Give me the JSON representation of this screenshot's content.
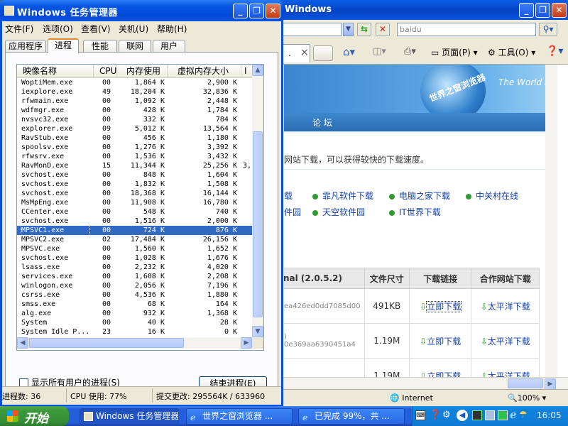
{
  "colors": {
    "xp_blue": "#0a4fd8",
    "selection": "#316ac5",
    "start_green": "#3c9a3c",
    "link": "#1440a6"
  },
  "browser": {
    "title": "Windows",
    "address_text": "baidu",
    "tab_close": "×",
    "toolbar": {
      "page": "页面(P)",
      "tools": "工具(O)"
    },
    "banner_text": "世界之窗浏览器",
    "banner_en": "The World B",
    "nav": "论 坛",
    "notice": "网站下载，可以获得较快的下载速度。",
    "mirrors_row1": [
      "载",
      "霏凡软件下载",
      "电脑之家下载",
      "中关村在线"
    ],
    "mirrors_row2": [
      "件园",
      "天空软件园",
      "IT世界下载"
    ],
    "table": {
      "headers": [
        "nal (2.0.5.2)",
        "文件尺寸",
        "下载链接",
        "合作网站下载"
      ],
      "rows": [
        {
          "name": "",
          "hash": "ea426ed0dd7085d00",
          "size": "491KB",
          "link": "立即下载",
          "partner": "太平洋下载"
        },
        {
          "name": ")",
          "hash": "0e369aa6390451a4",
          "size": "1.19M",
          "link": "立即下载",
          "partner": "太平洋下载"
        },
        {
          "name": "",
          "hash": "",
          "size": "1.19M",
          "link": "立即下载",
          "partner": "太平洋下载"
        }
      ]
    },
    "status": {
      "zone": "Internet",
      "zoom": "100%"
    }
  },
  "tm": {
    "title": "Windows 任务管理器",
    "menu": [
      "文件(F)",
      "选项(O)",
      "查看(V)",
      "关机(U)",
      "帮助(H)"
    ],
    "tabs": [
      "应用程序",
      "进程",
      "性能",
      "联网",
      "用户"
    ],
    "columns": [
      "映像名称",
      "CPU",
      "内存使用",
      "虚拟内存大小",
      "I"
    ],
    "processes": [
      {
        "name": "WoptiMem.exe",
        "cpu": "00",
        "mem": "1,864 K",
        "vm": "2,900 K",
        "extra": ""
      },
      {
        "name": "iexplore.exe",
        "cpu": "49",
        "mem": "18,204 K",
        "vm": "32,836 K",
        "extra": ""
      },
      {
        "name": "rfwmain.exe",
        "cpu": "00",
        "mem": "1,092 K",
        "vm": "2,448 K",
        "extra": ""
      },
      {
        "name": "wdfmgr.exe",
        "cpu": "00",
        "mem": "428 K",
        "vm": "1,784 K",
        "extra": ""
      },
      {
        "name": "nvsvc32.exe",
        "cpu": "00",
        "mem": "332 K",
        "vm": "784 K",
        "extra": ""
      },
      {
        "name": "explorer.exe",
        "cpu": "09",
        "mem": "5,012 K",
        "vm": "13,564 K",
        "extra": ""
      },
      {
        "name": "RavStub.exe",
        "cpu": "00",
        "mem": "456 K",
        "vm": "1,180 K",
        "extra": ""
      },
      {
        "name": "spoolsv.exe",
        "cpu": "00",
        "mem": "1,276 K",
        "vm": "3,392 K",
        "extra": ""
      },
      {
        "name": "rfwsrv.exe",
        "cpu": "00",
        "mem": "1,536 K",
        "vm": "3,432 K",
        "extra": ""
      },
      {
        "name": "RavMonD.exe",
        "cpu": "15",
        "mem": "11,344 K",
        "vm": "25,256 K",
        "extra": "3,"
      },
      {
        "name": "svchost.exe",
        "cpu": "00",
        "mem": "848 K",
        "vm": "1,604 K",
        "extra": ""
      },
      {
        "name": "svchost.exe",
        "cpu": "00",
        "mem": "1,832 K",
        "vm": "1,508 K",
        "extra": ""
      },
      {
        "name": "svchost.exe",
        "cpu": "00",
        "mem": "18,368 K",
        "vm": "16,144 K",
        "extra": ""
      },
      {
        "name": "MsMpEng.exe",
        "cpu": "00",
        "mem": "11,908 K",
        "vm": "16,780 K",
        "extra": ""
      },
      {
        "name": "CCenter.exe",
        "cpu": "00",
        "mem": "548 K",
        "vm": "740 K",
        "extra": ""
      },
      {
        "name": "svchost.exe",
        "cpu": "00",
        "mem": "1,516 K",
        "vm": "2,000 K",
        "extra": ""
      },
      {
        "name": "MPSVC1.exe",
        "cpu": "00",
        "mem": "724 K",
        "vm": "876 K",
        "extra": ""
      },
      {
        "name": "MPSVC2.exe",
        "cpu": "02",
        "mem": "17,484 K",
        "vm": "26,156 K",
        "extra": ""
      },
      {
        "name": "MPSVC.exe",
        "cpu": "00",
        "mem": "1,560 K",
        "vm": "1,652 K",
        "extra": ""
      },
      {
        "name": "svchost.exe",
        "cpu": "00",
        "mem": "1,028 K",
        "vm": "1,676 K",
        "extra": ""
      },
      {
        "name": "lsass.exe",
        "cpu": "00",
        "mem": "2,232 K",
        "vm": "4,020 K",
        "extra": ""
      },
      {
        "name": "services.exe",
        "cpu": "00",
        "mem": "1,608 K",
        "vm": "2,208 K",
        "extra": ""
      },
      {
        "name": "winlogon.exe",
        "cpu": "00",
        "mem": "2,056 K",
        "vm": "7,196 K",
        "extra": ""
      },
      {
        "name": "csrss.exe",
        "cpu": "00",
        "mem": "4,536 K",
        "vm": "1,880 K",
        "extra": ""
      },
      {
        "name": "smss.exe",
        "cpu": "00",
        "mem": "68 K",
        "vm": "164 K",
        "extra": ""
      },
      {
        "name": "alg.exe",
        "cpu": "00",
        "mem": "932 K",
        "vm": "1,368 K",
        "extra": ""
      },
      {
        "name": "System",
        "cpu": "00",
        "mem": "40 K",
        "vm": "28 K",
        "extra": ""
      },
      {
        "name": "System Idle P...",
        "cpu": "23",
        "mem": "16 K",
        "vm": "0 K",
        "extra": ""
      }
    ],
    "selected_process": "MPSVC1.exe",
    "show_all": "显示所有用户的进程(S)",
    "end_process": "结束进程(E)",
    "status": {
      "procs": "进程数: 36",
      "cpu": "CPU 使用: 77%",
      "commit": "提交更改: 295564K / 633960"
    }
  },
  "taskbar": {
    "start": "开始",
    "buttons": [
      "Windows 任务管理器",
      "世界之窗浏览器 ...",
      "已完成 99%，共 ..."
    ],
    "clock": "16:05"
  }
}
